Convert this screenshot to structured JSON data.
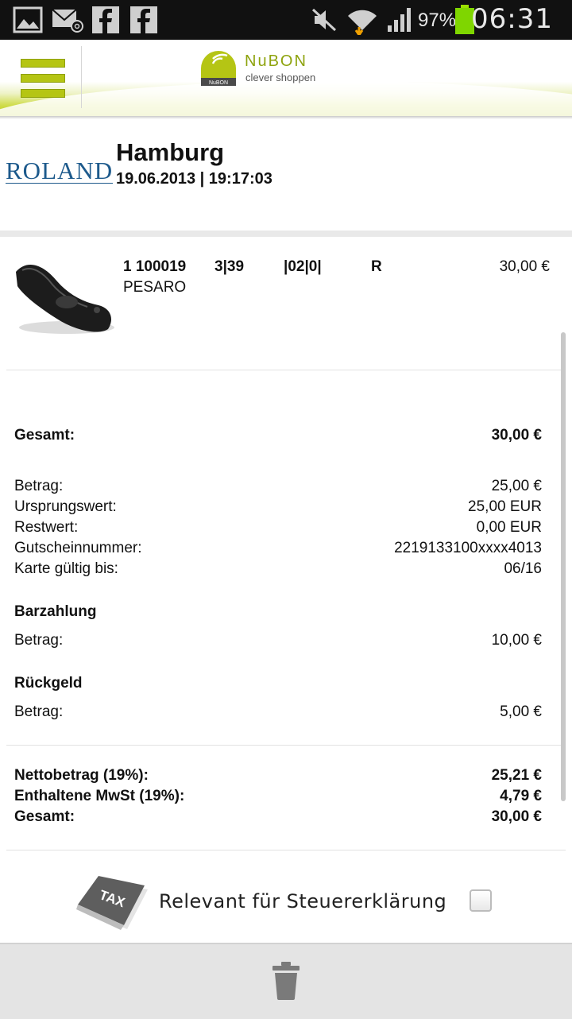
{
  "statusbar": {
    "battery_percent": "97%",
    "time": "06:31",
    "icons": [
      "gallery-icon",
      "email-icon",
      "facebook-icon",
      "facebook-icon",
      "mute-icon",
      "wifi-icon",
      "signal-icon",
      "battery-icon"
    ]
  },
  "header": {
    "logo_name": "NuBON",
    "logo_tagline": "clever shoppen",
    "logo_badge": "NuBON",
    "accent_color": "#b5c514"
  },
  "store": {
    "logo_text": "ROLAND",
    "city": "Hamburg",
    "datetime": "19.06.2013 | 19:17:03"
  },
  "item": {
    "code": "1 100019",
    "size": "3|39",
    "variant": "|02|0|",
    "flag": "R",
    "price": "30,00 €",
    "name": "PESARO"
  },
  "total": {
    "label": "Gesamt:",
    "value": "30,00 €"
  },
  "voucher": {
    "rows": [
      {
        "label": "Betrag:",
        "value": "25,00 €"
      },
      {
        "label": "Ursprungswert:",
        "value": "25,00 EUR"
      },
      {
        "label": "Restwert:",
        "value": "0,00 EUR"
      },
      {
        "label": "Gutscheinnummer:",
        "value": "2219133100xxxx4013"
      },
      {
        "label": "Karte gültig bis:",
        "value": "06/16"
      }
    ]
  },
  "cash": {
    "heading": "Barzahlung",
    "label": "Betrag:",
    "value": "10,00 €"
  },
  "change": {
    "heading": "Rückgeld",
    "label": "Betrag:",
    "value": "5,00 €"
  },
  "tax_summary": {
    "rows": [
      {
        "label": "Nettobetrag (19%):",
        "value": "25,21 €"
      },
      {
        "label": "Enthaltene MwSt (19%):",
        "value": "4,79 €"
      },
      {
        "label": "Gesamt:",
        "value": "30,00 €"
      }
    ]
  },
  "tax_relevant": {
    "icon_text": "TAX",
    "label": "Relevant für Steuererklärung",
    "checked": false
  }
}
